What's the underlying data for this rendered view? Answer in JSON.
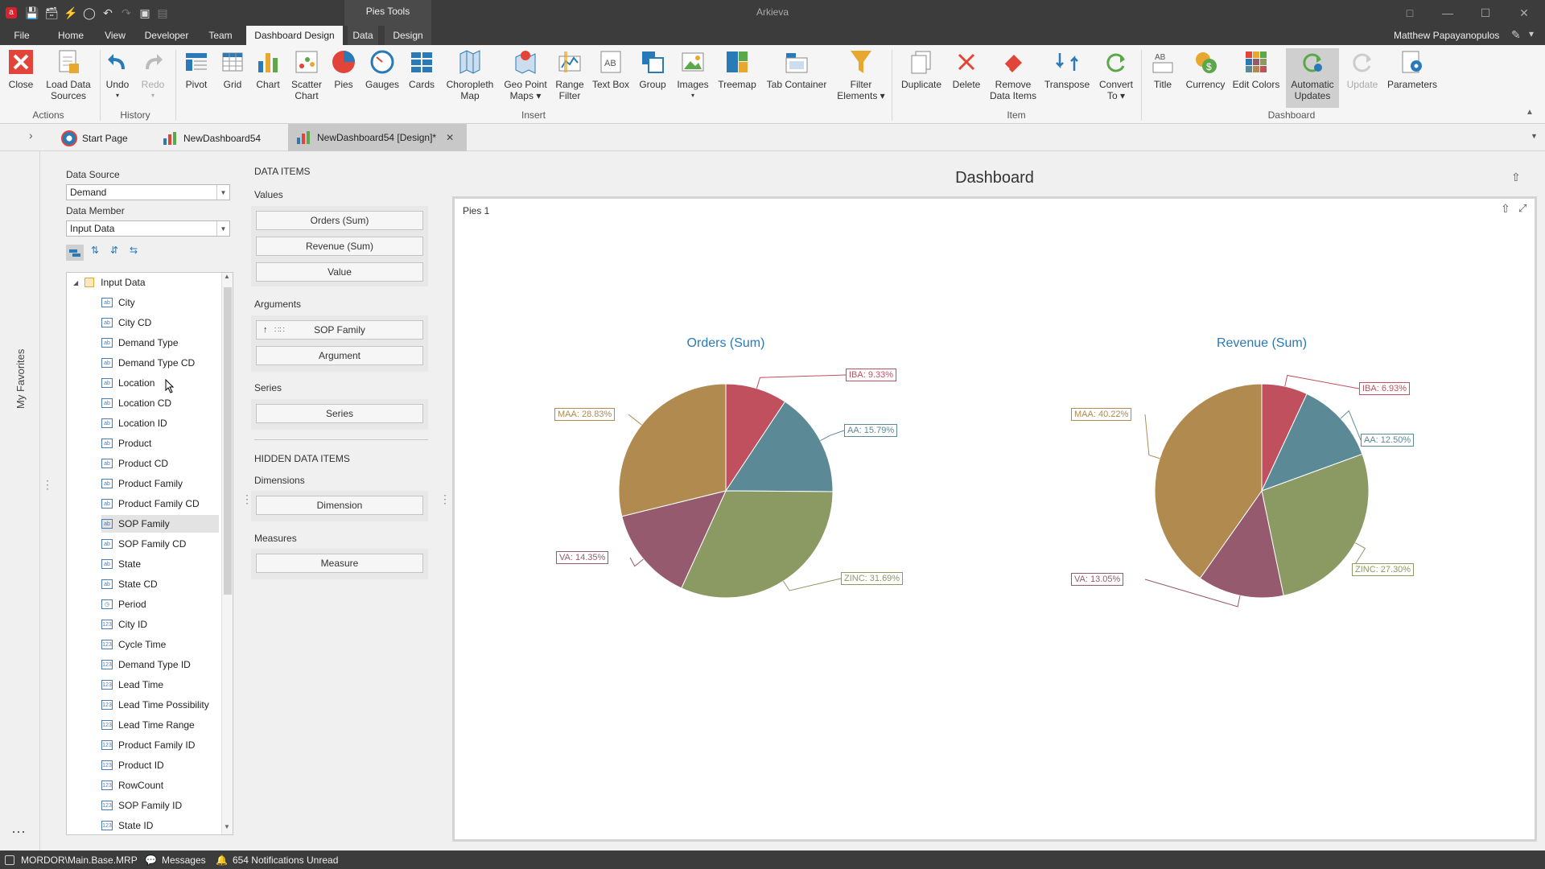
{
  "titlebar": {
    "app_title": "Arkieva",
    "context_tab": "Pies Tools",
    "user": "Matthew Papayanopulos"
  },
  "menu": {
    "tabs": [
      "File",
      "Home",
      "View",
      "Developer",
      "Team",
      "Dashboard Design",
      "Data",
      "Design"
    ],
    "active": "Dashboard Design"
  },
  "ribbon": {
    "buttons": {
      "close": "Close",
      "load_data_sources_1": "Load Data",
      "load_data_sources_2": "Sources",
      "undo": "Undo",
      "redo": "Redo",
      "pivot": "Pivot",
      "grid": "Grid",
      "chart": "Chart",
      "scatter_1": "Scatter",
      "scatter_2": "Chart",
      "pies": "Pies",
      "gauges": "Gauges",
      "cards": "Cards",
      "choropleth_1": "Choropleth",
      "choropleth_2": "Map",
      "geopoint_1": "Geo Point",
      "geopoint_2": "Maps",
      "range_1": "Range",
      "range_2": "Filter",
      "text_box": "Text Box",
      "group": "Group",
      "images": "Images",
      "treemap": "Treemap",
      "tab_container": "Tab Container",
      "filter_1": "Filter",
      "filter_2": "Elements",
      "duplicate": "Duplicate",
      "delete": "Delete",
      "remove_1": "Remove",
      "remove_2": "Data Items",
      "transpose": "Transpose",
      "convert_1": "Convert",
      "convert_2": "To",
      "title": "Title",
      "currency": "Currency",
      "edit_colors": "Edit Colors",
      "auto_1": "Automatic",
      "auto_2": "Updates",
      "update": "Update",
      "parameters": "Parameters"
    },
    "groups": {
      "actions": "Actions",
      "history": "History",
      "insert": "Insert",
      "item": "Item",
      "dashboard": "Dashboard"
    }
  },
  "doc_tabs": {
    "start_page": "Start Page",
    "dash": "NewDashboard54",
    "design": "NewDashboard54 [Design]*"
  },
  "left_strip": {
    "favorites": "My Favorites"
  },
  "field_panel": {
    "data_source_label": "Data Source",
    "data_source_value": "Demand",
    "data_member_label": "Data Member",
    "data_member_value": "Input Data",
    "root": "Input Data",
    "fields": [
      "City",
      "City CD",
      "Demand Type",
      "Demand Type CD",
      "Location",
      "Location CD",
      "Location ID",
      "Product",
      "Product CD",
      "Product Family",
      "Product Family CD",
      "SOP Family",
      "SOP Family CD",
      "State",
      "State CD",
      "Period",
      "City ID",
      "Cycle Time",
      "Demand Type ID",
      "Lead Time",
      "Lead Time Possibility",
      "Lead Time Range",
      "Product Family ID",
      "Product ID",
      "RowCount",
      "SOP Family ID",
      "State ID"
    ],
    "field_icons": [
      "ab",
      "ab",
      "ab",
      "ab",
      "ab",
      "ab",
      "ab",
      "ab",
      "ab",
      "ab",
      "ab",
      "ab",
      "ab",
      "ab",
      "ab",
      "clock",
      "123",
      "123",
      "123",
      "123",
      "123",
      "123",
      "123",
      "123",
      "123",
      "123",
      "123"
    ],
    "selected": "SOP Family"
  },
  "data_items": {
    "header": "DATA ITEMS",
    "values_label": "Values",
    "values": [
      "Orders (Sum)",
      "Revenue (Sum)",
      "Value"
    ],
    "arguments_label": "Arguments",
    "arguments": [
      "SOP Family",
      "Argument"
    ],
    "series_label": "Series",
    "series": [
      "Series"
    ],
    "hidden_header": "HIDDEN DATA ITEMS",
    "dimensions_label": "Dimensions",
    "dimensions": [
      "Dimension"
    ],
    "measures_label": "Measures",
    "measures": [
      "Measure"
    ]
  },
  "dashboard": {
    "title": "Dashboard",
    "panel_title": "Pies 1"
  },
  "chart_data": [
    {
      "type": "pie",
      "title": "Orders (Sum)",
      "categories": [
        "IBA",
        "AA",
        "ZINC",
        "VA",
        "MAA"
      ],
      "values": [
        9.33,
        15.79,
        31.69,
        14.35,
        28.83
      ],
      "labels": [
        "IBA: 9.33%",
        "AA: 15.79%",
        "ZINC: 31.69%",
        "VA: 14.35%",
        "MAA: 28.83%"
      ]
    },
    {
      "type": "pie",
      "title": "Revenue (Sum)",
      "categories": [
        "IBA",
        "AA",
        "ZINC",
        "VA",
        "MAA"
      ],
      "values": [
        6.93,
        12.5,
        27.3,
        13.05,
        40.22
      ],
      "labels": [
        "IBA: 6.93%",
        "AA: 12.50%",
        "ZINC: 27.30%",
        "VA: 13.05%",
        "MAA: 40.22%"
      ]
    }
  ],
  "colors": {
    "IBA": "#c0505e",
    "AA": "#5b8a96",
    "ZINC": "#8a9a62",
    "VA": "#965a6e",
    "MAA": "#b08a4e",
    "accent": "#2a7ab8"
  },
  "status": {
    "path": "MORDOR\\Main.Base.MRP",
    "messages": "Messages",
    "notifications": "654 Notifications Unread"
  }
}
